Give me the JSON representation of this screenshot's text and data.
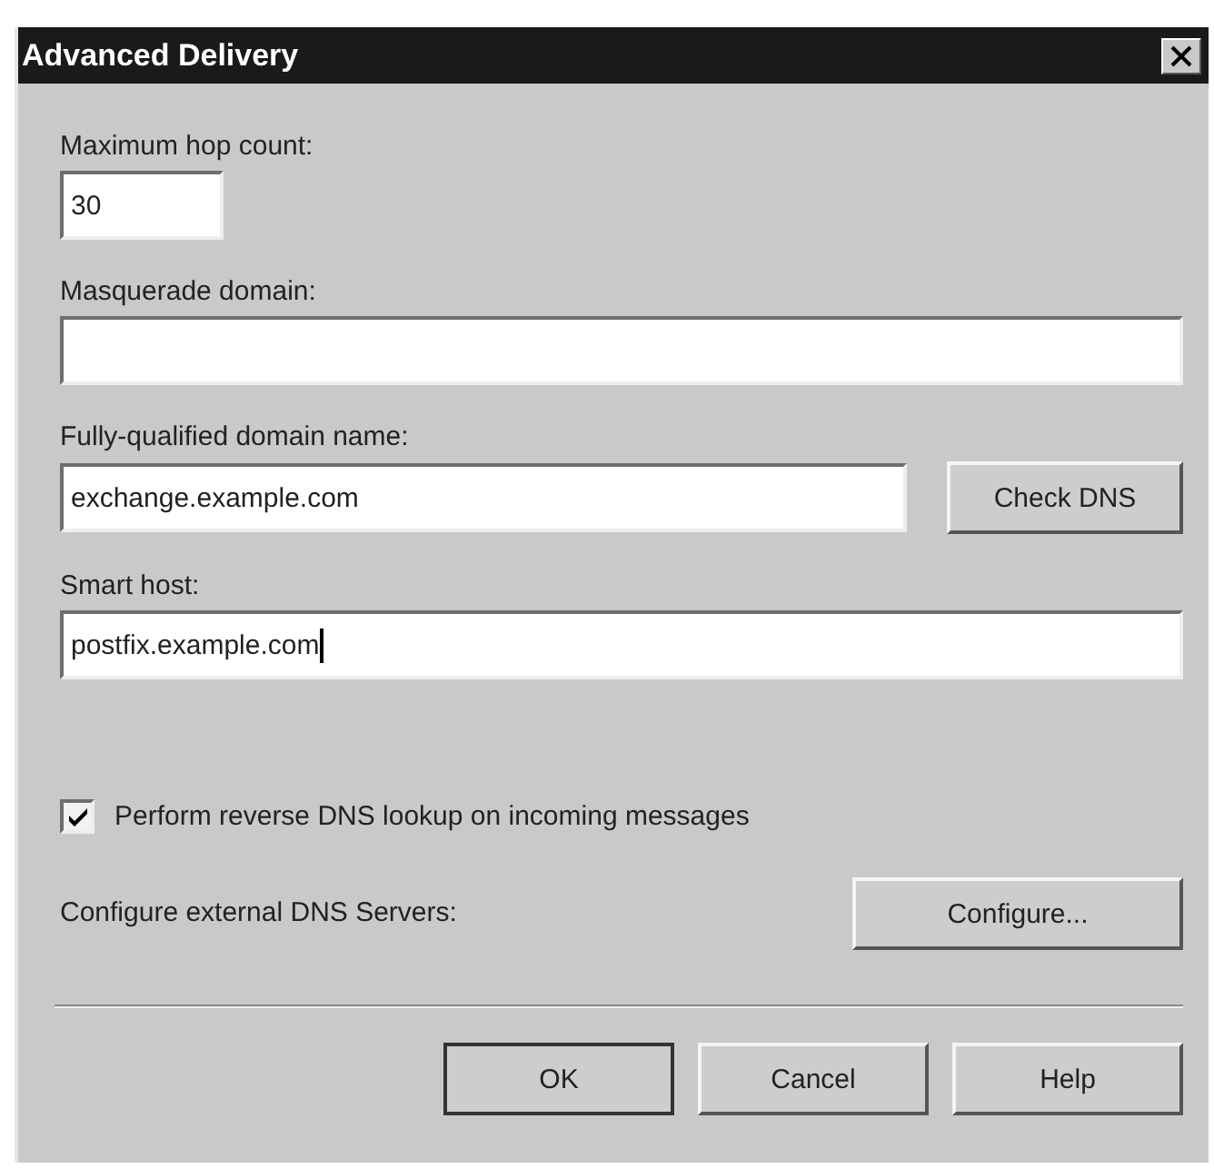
{
  "window": {
    "title": "Advanced Delivery"
  },
  "fields": [
    {
      "kind": "short",
      "label": "Maximum hop count:",
      "value": "30",
      "focused": false
    },
    {
      "kind": "wide",
      "label": "Masquerade domain:",
      "focused": false
    },
    {
      "kind": "with_button",
      "label": "Fully-qualified domain name:",
      "value": "exchange.example.com",
      "focused": false,
      "button": {
        "label": "Check DNS"
      }
    },
    {
      "kind": "wide",
      "label": "Smart host:",
      "value": "postfix.example.com",
      "focused": true
    }
  ],
  "reverse_dns": {
    "label": "Perform reverse DNS lookup on incoming messages",
    "checked": true
  },
  "dns_servers": {
    "label": "Configure external DNS Servers:",
    "button": {
      "label": "Configure..."
    }
  },
  "buttons": [
    {
      "label": "OK",
      "default": true
    },
    {
      "label": "Cancel",
      "default": false
    },
    {
      "label": "Help",
      "default": false
    }
  ]
}
